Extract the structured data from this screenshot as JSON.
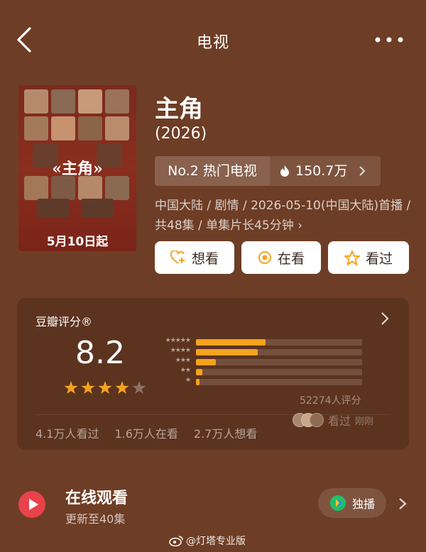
{
  "header": {
    "title": "电视",
    "back_icon": "back-arrow-icon",
    "more_icon": "more-dots-icon"
  },
  "poster": {
    "title": "«主角»",
    "date": "5月10日起"
  },
  "show": {
    "name": "主角",
    "year": "(2026)",
    "rank": "No.2 热门电视",
    "heat": "150.7万",
    "meta": "中国大陆 / 剧情 / 2026-05-10(中国大陆)首播 / 共48集 / 单集片长45分钟 ›"
  },
  "actions": {
    "want": "想看",
    "watching": "在看",
    "watched": "看过"
  },
  "rating": {
    "label": "豆瓣评分®",
    "score": "8.2",
    "stars_filled": 4,
    "stars_total": 5,
    "distribution": [
      {
        "stars": "★★★★★",
        "fraction": 0.42
      },
      {
        "stars": "★★★★",
        "fraction": 0.37
      },
      {
        "stars": "★★★",
        "fraction": 0.12
      },
      {
        "stars": "★★",
        "fraction": 0.04
      },
      {
        "stars": "★",
        "fraction": 0.02
      }
    ],
    "count": "52274人评分",
    "watched_count": "4.1万人看过",
    "watching_count": "1.6万人在看",
    "want_count": "2.7万人想看",
    "recent_label": "看过",
    "recent_time": "刚刚"
  },
  "watch": {
    "title": "在线观看",
    "subtitle": "更新至40集",
    "platform": "独播"
  },
  "watermark": "@灯塔专业版",
  "colors": {
    "background": "#6e3d25",
    "accent_bar": "#f5a21f",
    "star": "#f5a21f",
    "play": "#e8424a"
  }
}
